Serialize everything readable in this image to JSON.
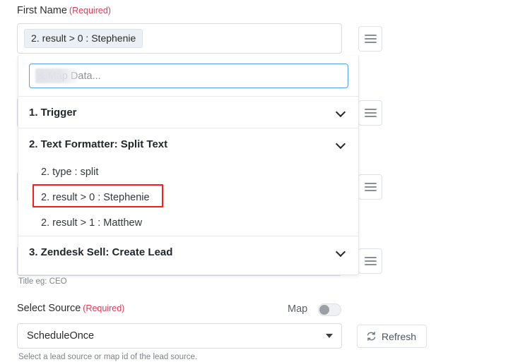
{
  "form": {
    "first_name": {
      "label": "First Name",
      "required_tag": "(Required)",
      "selected_token": "2. result > 0 : Stephenie",
      "helper_text": "Title eg: CEO"
    },
    "select_source": {
      "label": "Select Source",
      "required_tag": "(Required)",
      "selected_value": "ScheduleOnce",
      "helper_text": "Select a lead source or map id of the lead source.",
      "map_toggle_label": "Map",
      "map_toggle_state": "off",
      "refresh_label": "Refresh"
    }
  },
  "dropdown": {
    "search_placeholder": "& Map Data...",
    "groups": [
      {
        "title": "1. Trigger",
        "expanded": false,
        "options": []
      },
      {
        "title": "2. Text Formatter: Split Text",
        "expanded": true,
        "options": [
          "2. type : split",
          "2. result > 0 : Stephenie",
          "2. result > 1 : Matthew"
        ]
      },
      {
        "title": "3. Zendesk Sell: Create Lead",
        "expanded": false,
        "options": []
      }
    ]
  },
  "icons": {
    "hamburger": "hamburger-icon",
    "chevron": "chevron-down-icon",
    "caret": "caret-down-icon",
    "refresh": "refresh-icon"
  },
  "colors": {
    "required_red": "#e23a55",
    "annotation_red": "#ff1a1a",
    "focus_blue": "#4ea3e0",
    "chip_bg": "#eaf0f6",
    "border": "#d8dce1"
  }
}
